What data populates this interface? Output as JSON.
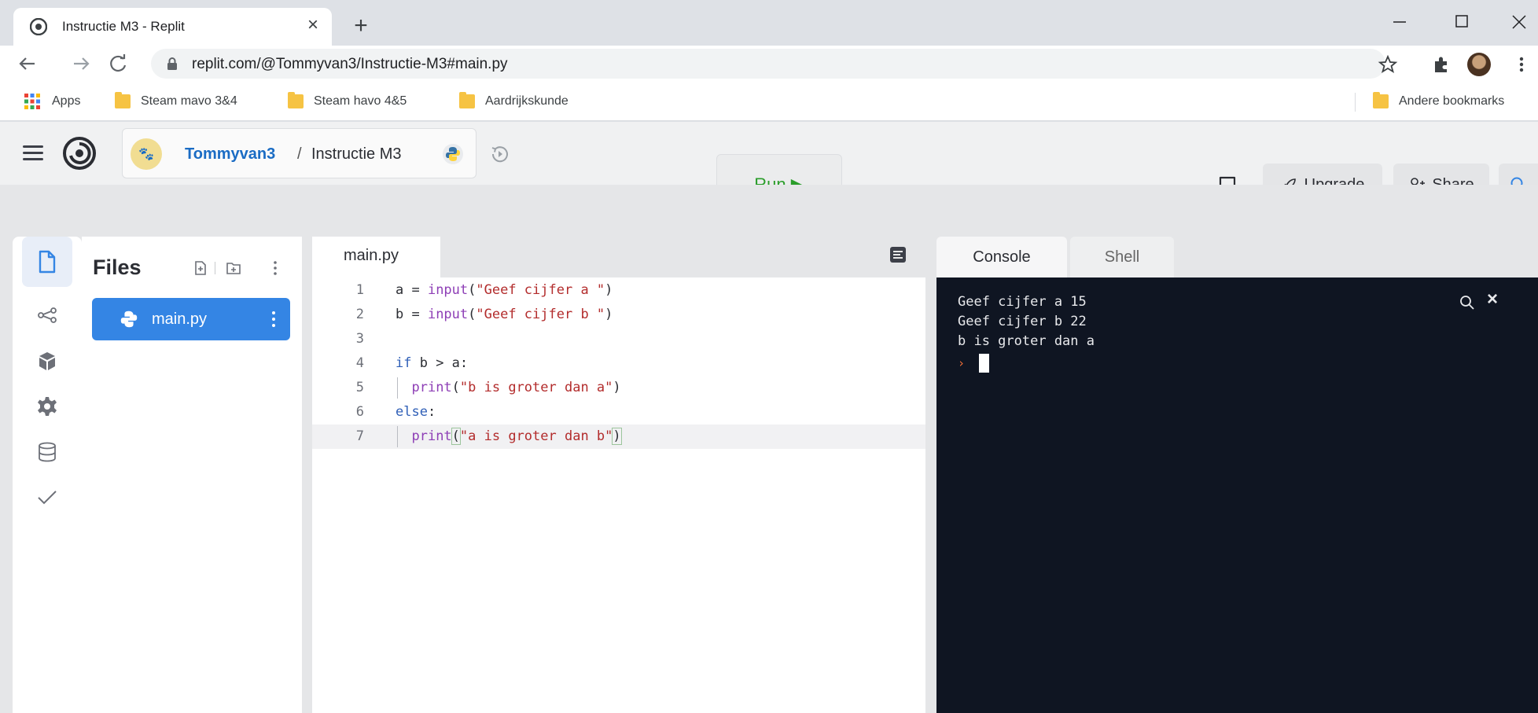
{
  "browser": {
    "tab_title": "Instructie M3 - Replit",
    "url_host": "replit.com",
    "url_path": "/@Tommyvan3/Instructie-M3#main.py",
    "bookmarks": [
      {
        "label": "Apps"
      },
      {
        "label": "Steam mavo 3&4"
      },
      {
        "label": "Steam havo 4&5"
      },
      {
        "label": "Aardrijkskunde"
      }
    ],
    "other_bookmarks": "Andere bookmarks"
  },
  "header": {
    "owner": "Tommyvan3",
    "separator": "/",
    "repl_name": "Instructie M3",
    "run_label": "Run ▶",
    "upgrade_label": "Upgrade",
    "share_label": "Share"
  },
  "files": {
    "title": "Files",
    "items": [
      {
        "name": "main.py"
      }
    ]
  },
  "editor": {
    "tab_label": "main.py",
    "lines": [
      {
        "n": "1"
      },
      {
        "n": "2"
      },
      {
        "n": "3"
      },
      {
        "n": "4"
      },
      {
        "n": "5"
      },
      {
        "n": "6"
      },
      {
        "n": "7"
      }
    ]
  },
  "console": {
    "tabs": [
      {
        "label": "Console"
      },
      {
        "label": "Shell"
      }
    ],
    "output": "Geef cijfer a 15\nGeef cijfer b 22\nb is groter dan a",
    "prompt_glyph": "›"
  },
  "colors": {
    "brand_blue": "#3485e4",
    "run_green": "#2a9d2a",
    "console_bg": "#0f1522"
  }
}
